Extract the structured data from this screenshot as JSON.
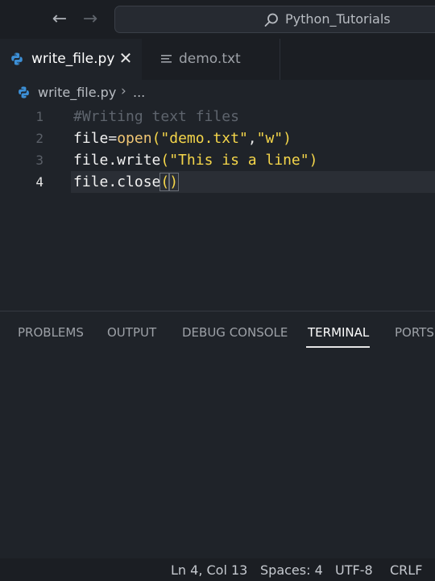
{
  "titlebar": {
    "nav_back_glyph": "←",
    "nav_forward_glyph": "→",
    "search_icon": "search-icon",
    "command_center_text": "Python_Tutorials"
  },
  "tabs": [
    {
      "label": "write_file.py",
      "icon": "python-icon",
      "close_glyph": "✕",
      "active": true
    },
    {
      "label": "demo.txt",
      "icon": "text-lines-icon",
      "active": false
    }
  ],
  "breadcrumb": {
    "file": "write_file.py",
    "separator": "›",
    "more": "..."
  },
  "editor": {
    "lines": [
      {
        "number": "1",
        "tokens": [
          {
            "t": "#Writing text files",
            "k": "comment"
          }
        ]
      },
      {
        "number": "2",
        "tokens": [
          {
            "t": "file",
            "k": "default"
          },
          {
            "t": "=",
            "k": "op"
          },
          {
            "t": "open",
            "k": "func"
          },
          {
            "t": "(",
            "k": "paren"
          },
          {
            "t": "\"demo.txt\"",
            "k": "str"
          },
          {
            "t": ",",
            "k": "op"
          },
          {
            "t": "\"w\"",
            "k": "str"
          },
          {
            "t": ")",
            "k": "paren"
          }
        ]
      },
      {
        "number": "3",
        "tokens": [
          {
            "t": "file.write",
            "k": "default"
          },
          {
            "t": "(",
            "k": "paren"
          },
          {
            "t": "\"This is a line\"",
            "k": "str"
          },
          {
            "t": ")",
            "k": "paren"
          }
        ]
      },
      {
        "number": "4",
        "tokens": [
          {
            "t": "file.close",
            "k": "default"
          },
          {
            "t": "(",
            "k": "parenhl"
          },
          {
            "t": ")",
            "k": "parenhl"
          }
        ]
      }
    ],
    "current_line": "4",
    "colors": {
      "comment": "#5e646d",
      "default": "#f2f2f2",
      "func": "#f0c674",
      "string": "#f5d64a"
    }
  },
  "panel": {
    "tabs": [
      {
        "label": "PROBLEMS",
        "active": false
      },
      {
        "label": "OUTPUT",
        "active": false
      },
      {
        "label": "DEBUG CONSOLE",
        "active": false
      },
      {
        "label": "TERMINAL",
        "active": true
      },
      {
        "label": "PORTS",
        "active": false
      }
    ]
  },
  "statusbar": {
    "position": "Ln 4, Col 13",
    "spaces": "Spaces: 4",
    "encoding": "UTF-8",
    "eol": "CRLF"
  }
}
